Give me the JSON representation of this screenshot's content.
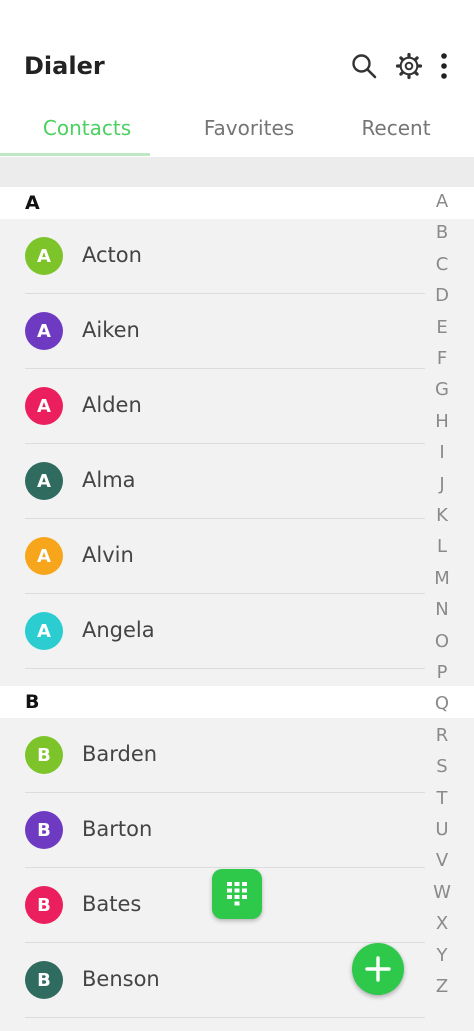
{
  "header": {
    "title": "Dialer"
  },
  "tabs": [
    {
      "label": "Contacts",
      "active": true
    },
    {
      "label": "Favorites",
      "active": false
    },
    {
      "label": "Recent",
      "active": false
    }
  ],
  "sections": [
    {
      "letter": "A",
      "contacts": [
        {
          "initial": "A",
          "name": "Acton",
          "color": "#7dc42a"
        },
        {
          "initial": "A",
          "name": "Aiken",
          "color": "#6f3ac2"
        },
        {
          "initial": "A",
          "name": "Alden",
          "color": "#ec1f5e"
        },
        {
          "initial": "A",
          "name": "Alma",
          "color": "#2f6b5e"
        },
        {
          "initial": "A",
          "name": "Alvin",
          "color": "#f7a51b"
        },
        {
          "initial": "A",
          "name": "Angela",
          "color": "#2ccdd0"
        }
      ]
    },
    {
      "letter": "B",
      "contacts": [
        {
          "initial": "B",
          "name": "Barden",
          "color": "#7dc42a"
        },
        {
          "initial": "B",
          "name": "Barton",
          "color": "#6f3ac2"
        },
        {
          "initial": "B",
          "name": "Bates",
          "color": "#ec1f5e"
        },
        {
          "initial": "B",
          "name": "Benson",
          "color": "#2f6b5e"
        }
      ]
    }
  ],
  "alphabet": [
    "A",
    "B",
    "C",
    "D",
    "E",
    "F",
    "G",
    "H",
    "I",
    "J",
    "K",
    "L",
    "M",
    "N",
    "O",
    "P",
    "Q",
    "R",
    "S",
    "T",
    "U",
    "V",
    "W",
    "X",
    "Y",
    "Z"
  ],
  "icons": {
    "search": "search-icon",
    "settings": "gear-icon",
    "more": "more-vert-icon",
    "dialpad": "dialpad-icon",
    "add": "plus-icon"
  },
  "colors": {
    "accent": "#2ec84a",
    "tab_active": "#4cd060"
  }
}
